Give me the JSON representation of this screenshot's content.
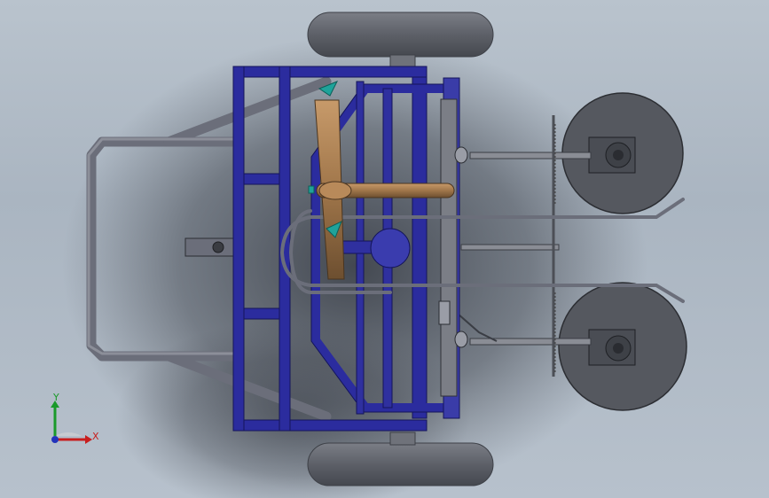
{
  "app": {
    "view": "Top"
  },
  "triad": {
    "y_label": "Y",
    "x_label": "X"
  },
  "colors": {
    "background": "#b5bfca",
    "frame_blue": "#2b2c9e",
    "frame_blue_dark": "#1c1d6e",
    "tube_gray": "#6b6e7a",
    "tire_gray": "#5e6169",
    "disc_gray": "#55585f",
    "wood_brown": "#a0764a",
    "teal_accent": "#1fa39a",
    "axis_y": "#1a9a2a",
    "axis_x": "#c81e1e",
    "axis_z": "#2233bb"
  }
}
